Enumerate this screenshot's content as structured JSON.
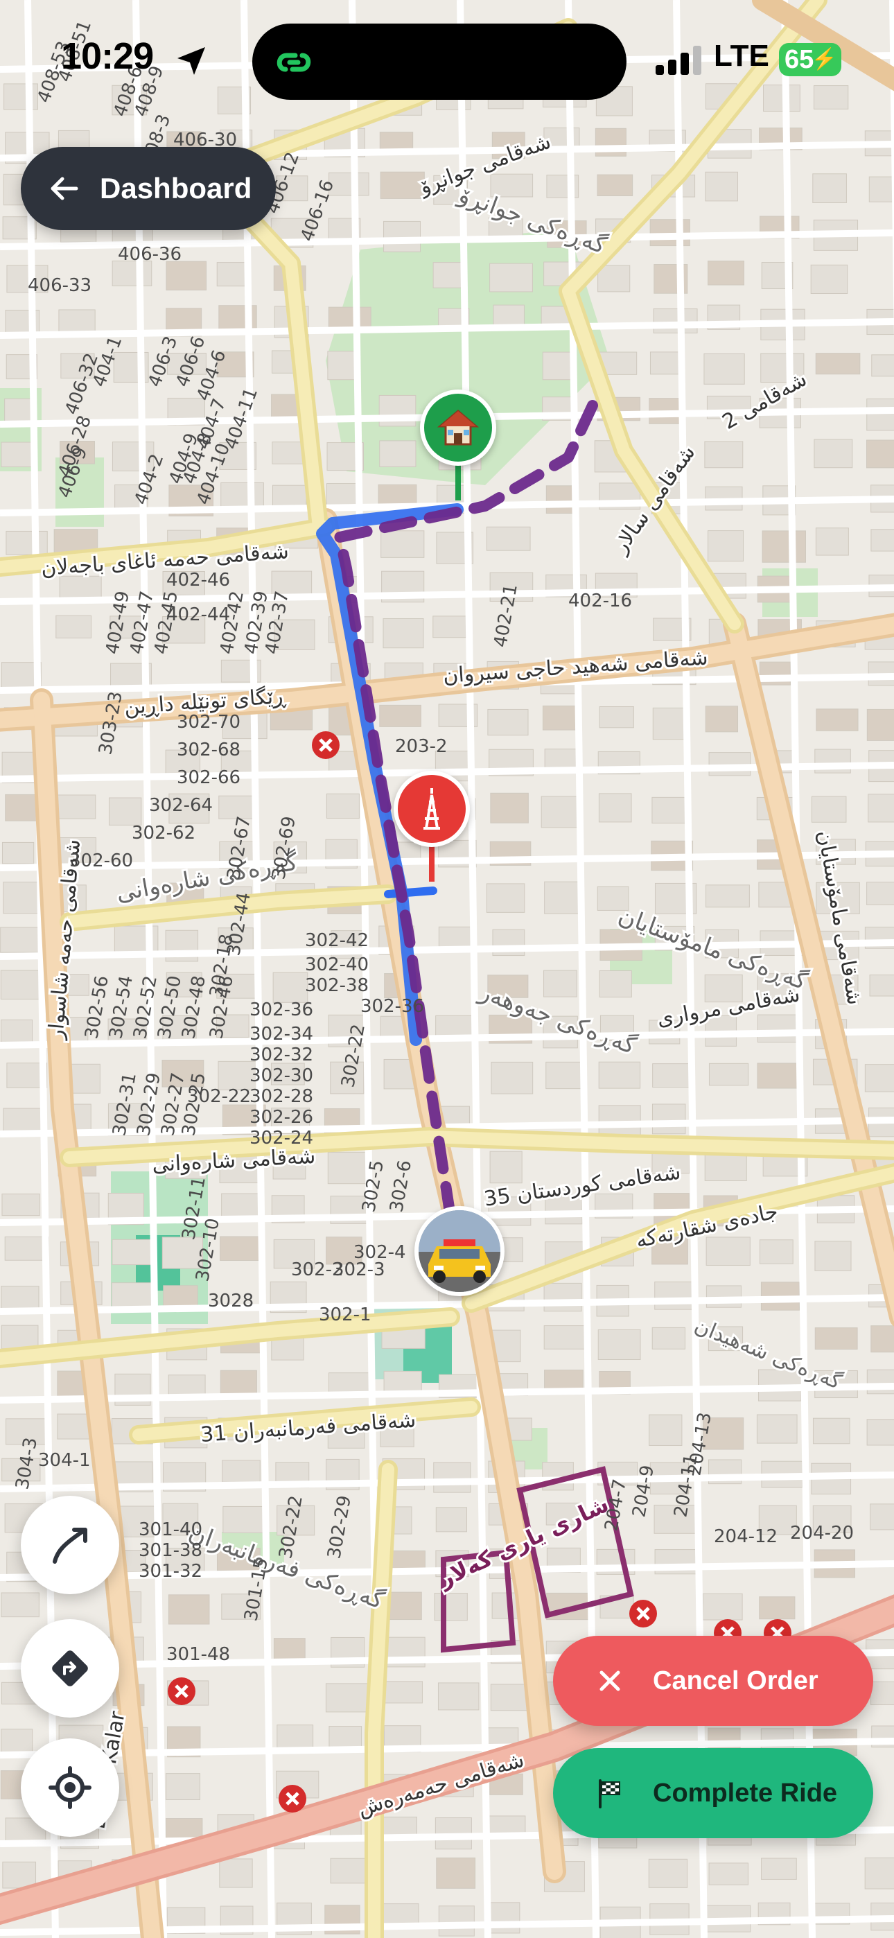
{
  "status_bar": {
    "time": "10:29",
    "network": "LTE",
    "battery": "65"
  },
  "dashboard_button": {
    "label": "Dashboard"
  },
  "map": {
    "labels": {
      "street_salar": "شەقامی سالار",
      "street_haji_sirwan": "شەقامی شەهید حاجی سیروان",
      "tunnel_road": "ڕێگای تونێلە داڕین",
      "street_shahrawani": "شەقامی شارەوانی",
      "street_kurdistan_35": "شەقامی کوردستان 35",
      "street_shaqam_2": "شەقامی 2",
      "street_agha": "شەقامی حەمە ئاغای باجەلان",
      "street_farmanbaran": "شەقامی فەرمانبەران 31",
      "city_park": "شاری یاری کەلار",
      "bazar": "Bazar Kalar",
      "gr_shahrawani": "گەڕەکی شارەوانی",
      "gr_mamostayan": "گەڕەکی مامۆستایان",
      "gr_jawhar": "گەڕەکی جەوهەر",
      "gr_shahidan": "گەڕەکی شەهیدان",
      "gr_farmanbaran": "گەڕەکی فەرمانبەران",
      "gr_jwanro": "گەڕەکی جوانڕۆ",
      "jadai_shaqartaka": "جادەی شقارتەکە",
      "street_jwanro": "شەقامی جوانڕۆ",
      "street_marwari": "شەقامی مرواری",
      "street_hama_shaswar": "شەقامی حەمە شاسوار",
      "street_amarakan": "شەقامی مامۆستایان",
      "street_haramarash": "شەقامی حەمەرەش",
      "nums": [
        "402-46",
        "402-44",
        "402-49",
        "402-47",
        "402-45",
        "402-42",
        "402-39",
        "402-37",
        "402-21",
        "402-16",
        "302-70",
        "302-68",
        "302-66",
        "302-64",
        "302-62",
        "302-60",
        "302-67",
        "302-69",
        "203-2",
        "302-42",
        "302-40",
        "302-38",
        "302-36",
        "302-36",
        "302-34",
        "302-32",
        "302-30",
        "302-28",
        "302-26",
        "302-24",
        "302-22",
        "302-22",
        "302-18",
        "302-56",
        "302-54",
        "302-52",
        "302-50",
        "302-48",
        "302-46",
        "302-44",
        "302-31",
        "302-29",
        "302-27",
        "302-25",
        "302-11",
        "302-10",
        "302-5",
        "302-6",
        "302-4",
        "302-2",
        "302-3",
        "302-1",
        "3028",
        "304-1",
        "304-3",
        "301-40",
        "301-38",
        "301-32",
        "301-48",
        "301-15",
        "302-22",
        "302-29",
        "303-23",
        "204-9",
        "204-11",
        "204-13",
        "204-12",
        "204-20",
        "204-7",
        "406-33",
        "406-36",
        "406-32",
        "406-28",
        "406-9",
        "406-6",
        "406-3",
        "404-1",
        "404-6",
        "404-11",
        "404-7",
        "404-8",
        "404-9",
        "404-10",
        "404-2",
        "406-12",
        "406-16",
        "408-6",
        "408-9",
        "408-3",
        "406-30",
        "408-51",
        "408-53"
      ]
    }
  },
  "pins": {
    "home_icon": "house-icon",
    "tower_icon": "tower-icon",
    "taxi_icon": "taxi-icon"
  },
  "buttons": {
    "cancel_label": "Cancel Order",
    "complete_label": "Complete Ride"
  },
  "colors": {
    "route_blue": "#2f6df0",
    "route_purple": "#6b2a8c",
    "cancel": "#ee5a5e",
    "complete": "#1fb77d",
    "home_pin": "#1e9e4b",
    "tower_pin": "#e53935",
    "pill": "#2e333c"
  }
}
